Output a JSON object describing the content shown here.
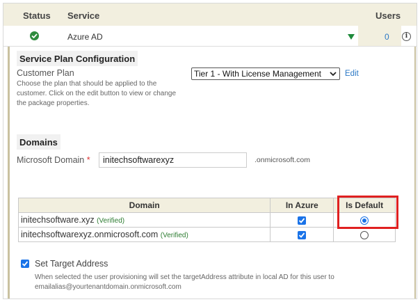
{
  "header": {
    "status": "Status",
    "service": "Service",
    "users": "Users"
  },
  "service_row": {
    "status_icon": "check-circle-icon",
    "name": "Azure AD",
    "users_count": "0",
    "info_icon": "info-icon",
    "info_glyph": "i"
  },
  "service_plan": {
    "title": "Service Plan Configuration",
    "customer_plan_label": "Customer Plan",
    "description": "Choose the plan that should be applied to the customer. Click on the edit button to view or change the package properties.",
    "selected_plan": "Tier 1 - With License Management",
    "edit_label": "Edit"
  },
  "domains": {
    "title": "Domains",
    "microsoft_domain_label": "Microsoft Domain",
    "required_mark": "*",
    "microsoft_domain_value": "initechsoftwarexyz",
    "suffix": ".onmicrosoft.com",
    "table": {
      "headers": [
        "Domain",
        "In Azure",
        "Is Default"
      ],
      "rows": [
        {
          "domain": "initechsoftware.xyz",
          "status": "(Verified)",
          "in_azure": true,
          "is_default": true
        },
        {
          "domain": "initechsoftwarexyz.onmicrosoft.com",
          "status": "(Verified)",
          "in_azure": true,
          "is_default": false
        }
      ]
    }
  },
  "target_address": {
    "label": "Set Target Address",
    "checked": true,
    "description": "When selected the user provisioning will set the targetAddress attribute in local AD for this user to emailalias@yourtenantdomain.onmicrosoft.com"
  },
  "colors": {
    "accent": "#1a73e8",
    "link": "#2b78c5",
    "header_bg": "#f2efdf",
    "ok_green": "#2e8b3d",
    "verified_green": "#2e7d32",
    "highlight_red": "#e02020"
  }
}
